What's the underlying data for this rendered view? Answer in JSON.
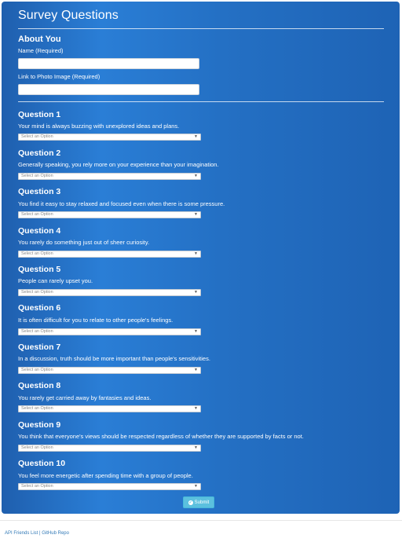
{
  "page": {
    "title": "Survey Questions"
  },
  "about": {
    "heading": "About You",
    "name_label": "Name (Required)",
    "name_value": "",
    "photo_label": "Link to Photo Image (Required)",
    "photo_value": ""
  },
  "select_placeholder": "Select an Option",
  "questions": [
    {
      "title": "Question 1",
      "text": "Your mind is always buzzing with unexplored ideas and plans.",
      "selected": "Select an Option"
    },
    {
      "title": "Question 2",
      "text": "Generally speaking, you rely more on your experience than your imagination.",
      "selected": "Select an Option"
    },
    {
      "title": "Question 3",
      "text": "You find it easy to stay relaxed and focused even when there is some pressure.",
      "selected": "Select an Option"
    },
    {
      "title": "Question 4",
      "text": "You rarely do something just out of sheer curiosity.",
      "selected": "Select an Option"
    },
    {
      "title": "Question 5",
      "text": "People can rarely upset you.",
      "selected": "Select an Option"
    },
    {
      "title": "Question 6",
      "text": "It is often difficult for you to relate to other people's feelings.",
      "selected": "Select an Option"
    },
    {
      "title": "Question 7",
      "text": "In a discussion, truth should be more important than people's sensitivities.",
      "selected": "Select an Option"
    },
    {
      "title": "Question 8",
      "text": "You rarely get carried away by fantasies and ideas.",
      "selected": "Select an Option"
    },
    {
      "title": "Question 9",
      "text": "You think that everyone's views should be respected regardless of whether they are supported by facts or not.",
      "selected": "Select an Option"
    },
    {
      "title": "Question 10",
      "text": "You feel more energetic after spending time with a group of people.",
      "selected": "Select an Option"
    }
  ],
  "submit": {
    "label": "Submit",
    "icon": "check-circle-icon"
  },
  "footer": {
    "link1": "API Friends List",
    "separator": "|",
    "link2": "GitHub Repo"
  },
  "colors": {
    "panel": "#2a7ed6",
    "submit": "#5bc0de",
    "link": "#337ab7"
  }
}
